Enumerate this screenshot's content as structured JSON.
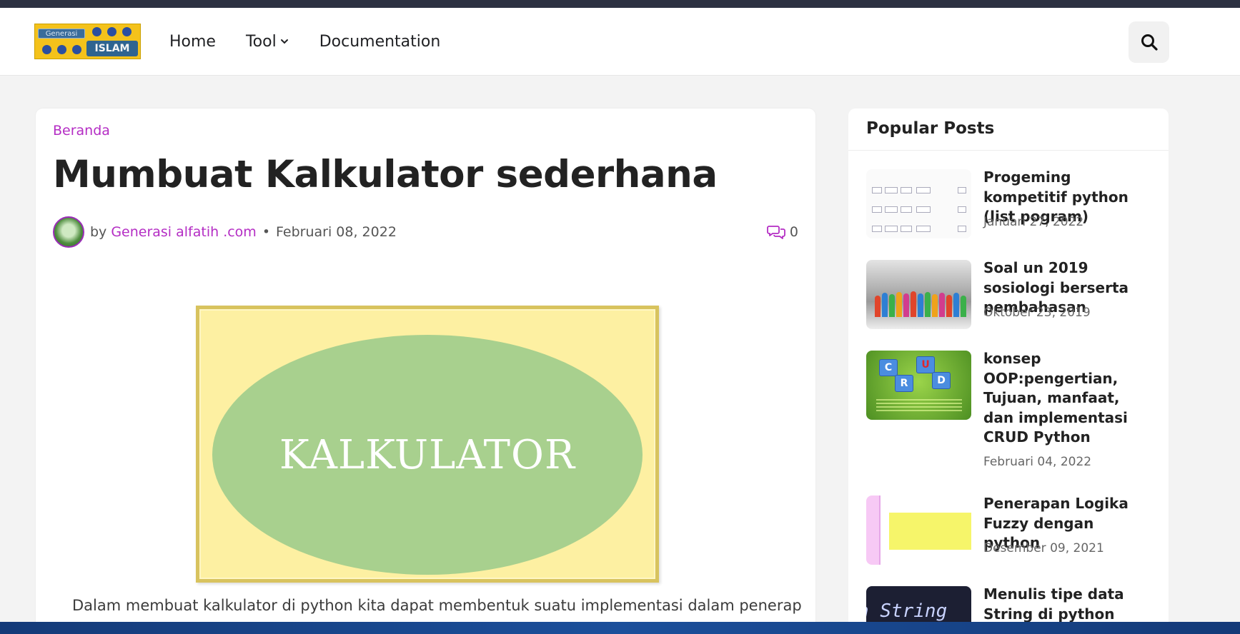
{
  "header": {
    "logo_text_top": "Generasi",
    "logo_text_bottom": "ISLAM",
    "nav": [
      {
        "label": "Home"
      },
      {
        "label": "Tool",
        "has_dropdown": true
      },
      {
        "label": "Documentation"
      }
    ],
    "search_icon": "search-icon"
  },
  "article": {
    "breadcrumb": "Beranda",
    "title": "Mumbuat Kalkulator sederhana",
    "by": "by",
    "author": "Generasi alfatih .com",
    "separator": "•",
    "date": "Februari 08, 2022",
    "comment_icon": "comments-icon",
    "comment_count": "0",
    "feature_image_text": "KALKULATOR",
    "body_text": "Dalam membuat kalkulator di python kita dapat membentuk suatu implementasi dalam penerapan tiap"
  },
  "sidebar": {
    "heading": "Popular Posts",
    "posts": [
      {
        "title": "Progeming kompetitif python (list pogram)",
        "date": "Januari 27, 2022"
      },
      {
        "title": "Soal un 2019 sosiologi berserta pembahasan",
        "date": "Oktober 23, 2019"
      },
      {
        "title": "konsep OOP:pengertian, Tujuan, manfaat, dan implementasi CRUD Python",
        "date": "Februari 04, 2022"
      },
      {
        "title": "Penerapan Logika Fuzzy dengan python",
        "date": "Desember 09, 2021"
      },
      {
        "title": "Menulis tipe data String di python",
        "date": ""
      }
    ],
    "thumb_texts": {
      "crud_letters": [
        "C",
        "U",
        "R",
        "D"
      ],
      "string_thumb": "n String"
    }
  },
  "colors": {
    "accent": "#b42dc4",
    "topbar": "#2c3142",
    "page_bg": "#f3f3f3"
  }
}
